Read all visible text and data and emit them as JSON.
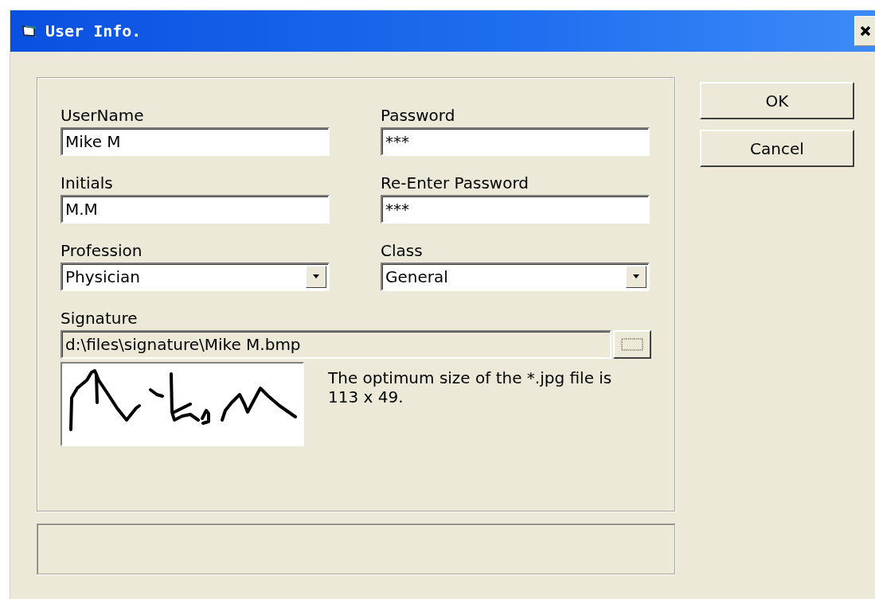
{
  "window": {
    "title": "User Info."
  },
  "fields": [
    {
      "label": "UserName",
      "value": "Mike M",
      "kind": "text"
    },
    {
      "label": "Password",
      "value": "***",
      "kind": "text"
    },
    {
      "label": "Initials",
      "value": "M.M",
      "kind": "text"
    },
    {
      "label": "Re-Enter Password",
      "value": "***",
      "kind": "text"
    },
    {
      "label": "Profession",
      "value": "Physician",
      "kind": "dropdown"
    },
    {
      "label": "Class",
      "value": "General",
      "kind": "dropdown"
    }
  ],
  "signature": {
    "label": "Signature",
    "path": "d:\\files\\signature\\Mike M.bmp",
    "hint": "The optimum size of the *.jpg file is 113 x 49."
  },
  "buttons": [
    "OK",
    "Cancel"
  ]
}
